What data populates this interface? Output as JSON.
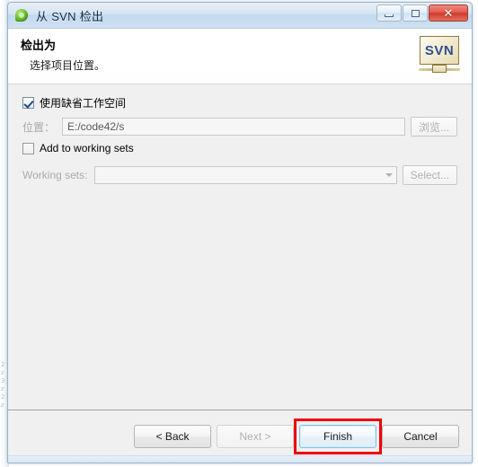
{
  "window": {
    "title": "从 SVN 检出",
    "icon": "svn-leaf-icon",
    "controls": {
      "minimize": "minimize-icon",
      "maximize": "maximize-icon",
      "close": "✕"
    }
  },
  "header": {
    "title": "检出为",
    "subtitle": "选择项目位置。",
    "banner_icon_text": "SVN"
  },
  "form": {
    "use_default_workspace": {
      "label": "使用缺省工作空间",
      "checked": true
    },
    "location": {
      "label": "位置：",
      "value": "E:/code42/s",
      "browse_label": "浏览...",
      "enabled": false
    },
    "add_to_working_sets": {
      "label": "Add to working sets",
      "checked": false
    },
    "working_sets": {
      "label": "Working sets:",
      "value": "",
      "select_label": "Select...",
      "enabled": false
    }
  },
  "buttons": {
    "back": "< Back",
    "next": "Next >",
    "finish": "Finish",
    "cancel": "Cancel"
  },
  "annotation": {
    "highlight_target": "Finish",
    "color": "#ef0000"
  },
  "colors": {
    "titlebar_blue": "#c2d9ee",
    "content_gray": "#f0f0f0",
    "close_red": "#cf3a2b",
    "svn_blue": "#2e4f8f",
    "annotation_red": "#ef0000",
    "default_button_border": "#7fc3e8"
  },
  "backdrop_artifacts": [
    "2",
    "z",
    "3",
    "z",
    "2",
    "z"
  ]
}
